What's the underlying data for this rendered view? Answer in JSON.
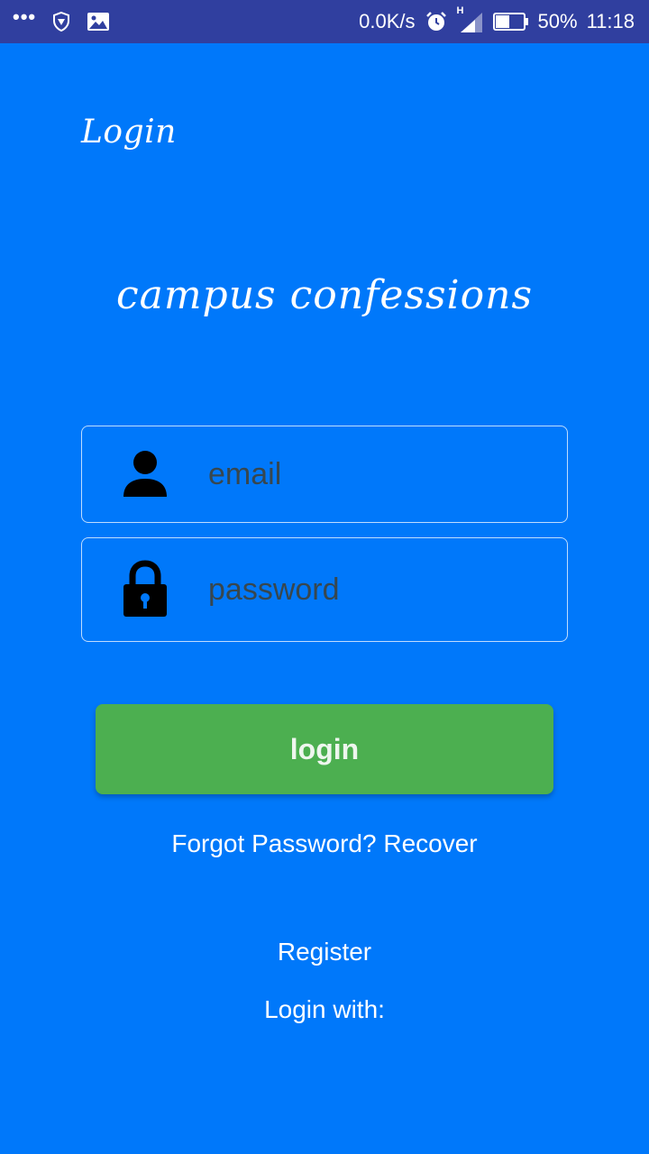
{
  "status_bar": {
    "dots": "•••",
    "net_speed": "0.0K/s",
    "network_type": "H",
    "battery": "50%",
    "time": "11:18"
  },
  "header": {
    "title": "Login"
  },
  "brand": {
    "app_name": "campus confessions"
  },
  "form": {
    "email_placeholder": "email",
    "password_placeholder": "password",
    "login_button": "login"
  },
  "links": {
    "forgot_text": "Forgot Password?",
    "recover_text": "Recover",
    "register": "Register",
    "login_with": "Login with:"
  },
  "colors": {
    "status_bar": "#303f9f",
    "background": "#0078fa",
    "login_button": "#4caf50",
    "text": "#ffffff"
  },
  "icons": {
    "email_field": "person-icon",
    "password_field": "lock-icon"
  }
}
